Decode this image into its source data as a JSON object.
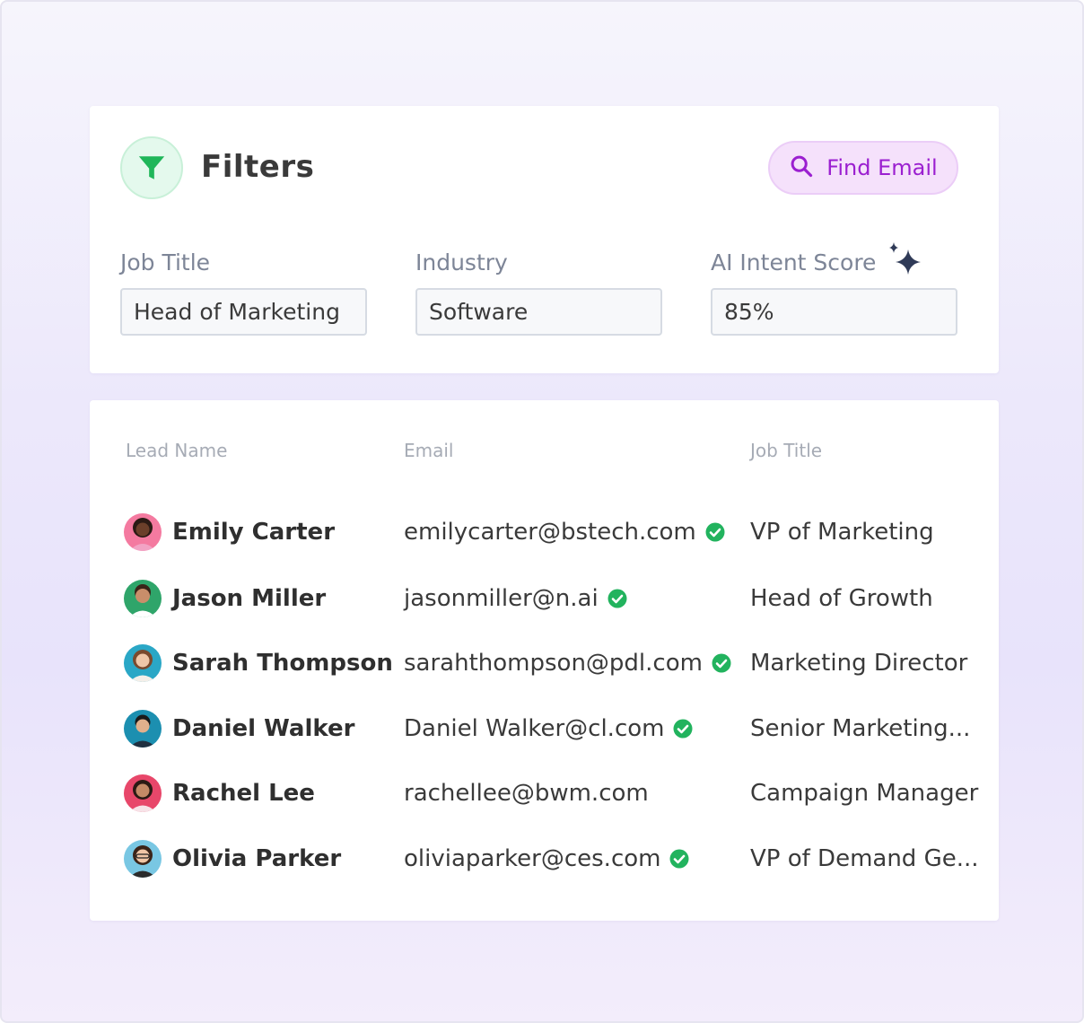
{
  "filters": {
    "title": "Filters",
    "icon": "filter-funnel-icon",
    "find_email_label": "Find Email",
    "fields": [
      {
        "label": "Job Title",
        "value": "Head of Marketing"
      },
      {
        "label": "Industry",
        "value": "Software"
      },
      {
        "label": "AI Intent Score",
        "value": "85%"
      }
    ]
  },
  "table": {
    "columns": [
      "Lead Name",
      "Email",
      "Job Title"
    ],
    "rows": [
      {
        "name": "Emily Carter",
        "email": "emilycarter@bstech.com",
        "verified": true,
        "job": "VP of Marketing",
        "avatar_bg": "#f47aa0"
      },
      {
        "name": "Jason Miller",
        "email": "jasonmiller@n.ai",
        "verified": true,
        "job": "Head of Growth",
        "avatar_bg": "#2fa56a"
      },
      {
        "name": "Sarah Thompson",
        "email": "sarahthompson@pdl.com",
        "verified": true,
        "job": "Marketing Director",
        "avatar_bg": "#2aa7c6"
      },
      {
        "name": "Daniel Walker",
        "email": "Daniel Walker@cl.com",
        "verified": true,
        "job": "Senior Marketing...",
        "avatar_bg": "#1c8fb0"
      },
      {
        "name": "Rachel Lee",
        "email": "rachellee@bwm.com",
        "verified": false,
        "job": "Campaign Manager",
        "avatar_bg": "#e8476a"
      },
      {
        "name": "Olivia Parker",
        "email": "oliviaparker@ces.com",
        "verified": true,
        "job": "VP of Demand Ge...",
        "avatar_bg": "#79c7e3"
      }
    ]
  },
  "colors": {
    "accent_purple": "#9b1fd0",
    "verified_green": "#22b35e",
    "filter_green": "#1fb659"
  }
}
